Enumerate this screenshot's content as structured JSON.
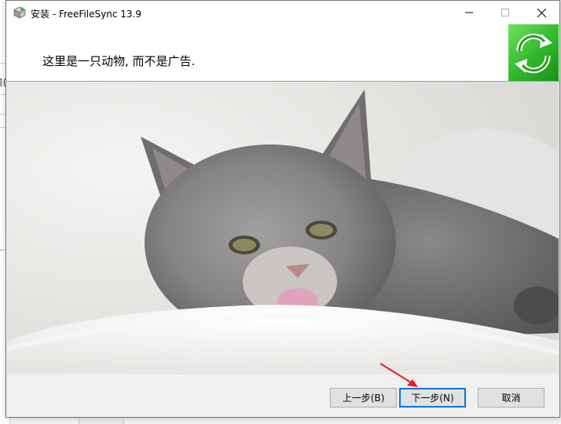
{
  "window": {
    "title": "安装 - FreeFileSync 13.9"
  },
  "header": {
    "text": "这里是一只动物, 而不是广告."
  },
  "background": {
    "partial_text": "¶("
  },
  "content": {
    "image_description": "kitten"
  },
  "buttons": {
    "back": "上一步(B)",
    "next": "下一步(N)",
    "cancel": "取消"
  },
  "colors": {
    "accent": "#0078d7",
    "logo_green": "#2fb82a",
    "annotation_arrow": "#e81f1f"
  }
}
